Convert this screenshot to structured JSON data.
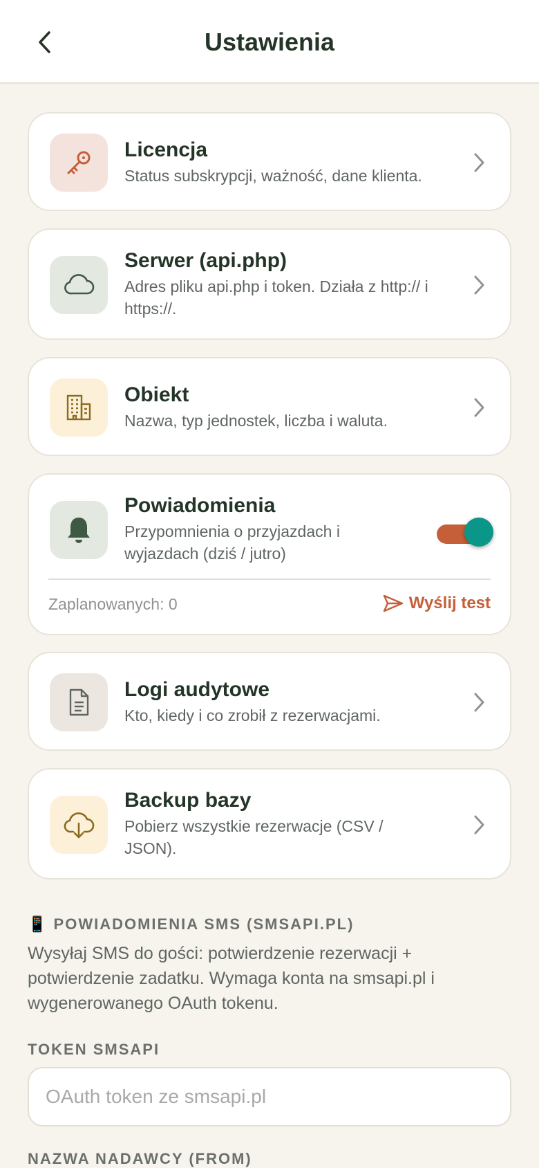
{
  "header": {
    "title": "Ustawienia",
    "back_icon": "chevron-left-icon"
  },
  "cards": [
    {
      "title": "Licencja",
      "description": "Status subskrypcji, ważność, dane klienta.",
      "icon": "key-icon",
      "icon_bg": "#f4e3dd",
      "icon_color": "#c45f3a"
    },
    {
      "title": "Serwer (api.php)",
      "description": "Adres pliku api.php i token. Działa z http:// i https://.",
      "icon": "cloud-icon",
      "icon_bg": "#e3e8e1",
      "icon_color": "#3f5a44"
    },
    {
      "title": "Obiekt",
      "description": "Nazwa, typ jednostek, liczba i waluta.",
      "icon": "building-icon",
      "icon_bg": "#fdf0d8",
      "icon_color": "#8a6b1f"
    },
    {
      "title": "Logi audytowe",
      "description": "Kto, kiedy i co zrobił z rezerwacjami.",
      "icon": "document-icon",
      "icon_bg": "#ebe7e0",
      "icon_color": "#5f6661"
    },
    {
      "title": "Backup bazy",
      "description": "Pobierz wszystkie rezerwacje (CSV / JSON).",
      "icon": "cloud-download-icon",
      "icon_bg": "#fdf0d8",
      "icon_color": "#8a6b1f"
    }
  ],
  "notifications": {
    "title": "Powiadomienia",
    "description": "Przypomnienia o przyjazdach i wyjazdach (dziś / jutro)",
    "icon": "bell-icon",
    "enabled": true,
    "scheduled": "Zaplanowanych: 0",
    "send_test": "Wyślij test"
  },
  "sms": {
    "emoji": "📱",
    "heading": "POWIADOMIENIA SMS (SMSAPI.PL)",
    "text": "Wysyłaj SMS do gości: potwierdzenie rezerwacji + potwierdzenie zadatku. Wymaga konta na smsapi.pl i wygenerowanego OAuth tokenu.",
    "token_label": "TOKEN SMSAPI",
    "token_placeholder": "OAuth token ze smsapi.pl",
    "token_value": "",
    "sender_label": "NAZWA NADAWCY (FROM)"
  },
  "colors": {
    "accent": "#c45f3a",
    "toggle_knob": "#0a9688",
    "background": "#f7f4ee"
  }
}
